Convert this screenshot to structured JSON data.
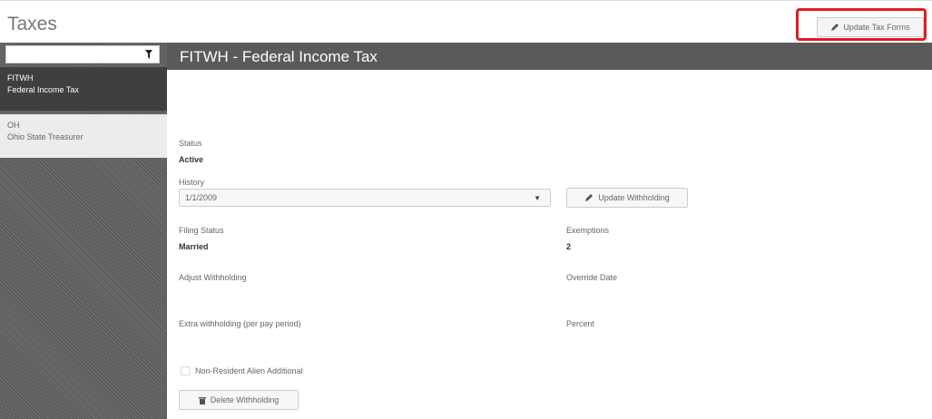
{
  "header": {
    "title": "Taxes",
    "update_tax_forms_label": "Update Tax Forms",
    "update_tax_forms_icon": "pencil-icon",
    "highlight_color": "#e11b22"
  },
  "sidebar": {
    "filter_value": "",
    "filter_icon": "filter-icon",
    "items": [
      {
        "code": "FITWH",
        "name": "Federal Income Tax",
        "selected": true
      },
      {
        "code": "OH",
        "name": "Ohio State Treasurer",
        "selected": false
      }
    ]
  },
  "detail": {
    "title": "FITWH - Federal Income Tax",
    "status_label": "Status",
    "status_value": "Active",
    "history_label": "History",
    "history_value": "1/1/2009",
    "update_withholding_label": "Update Withholding",
    "filing_status_label": "Filing Status",
    "filing_status_value": "Married",
    "exemptions_label": "Exemptions",
    "exemptions_value": "2",
    "adjust_withholding_label": "Adjust Withholding",
    "override_date_label": "Override Date",
    "extra_withholding_label": "Extra withholding (per pay period)",
    "percent_label": "Percent",
    "non_resident_label": "Non-Resident Alien Additional",
    "non_resident_checked": false,
    "delete_withholding_label": "Delete Withholding",
    "delete_icon": "trash-icon"
  }
}
